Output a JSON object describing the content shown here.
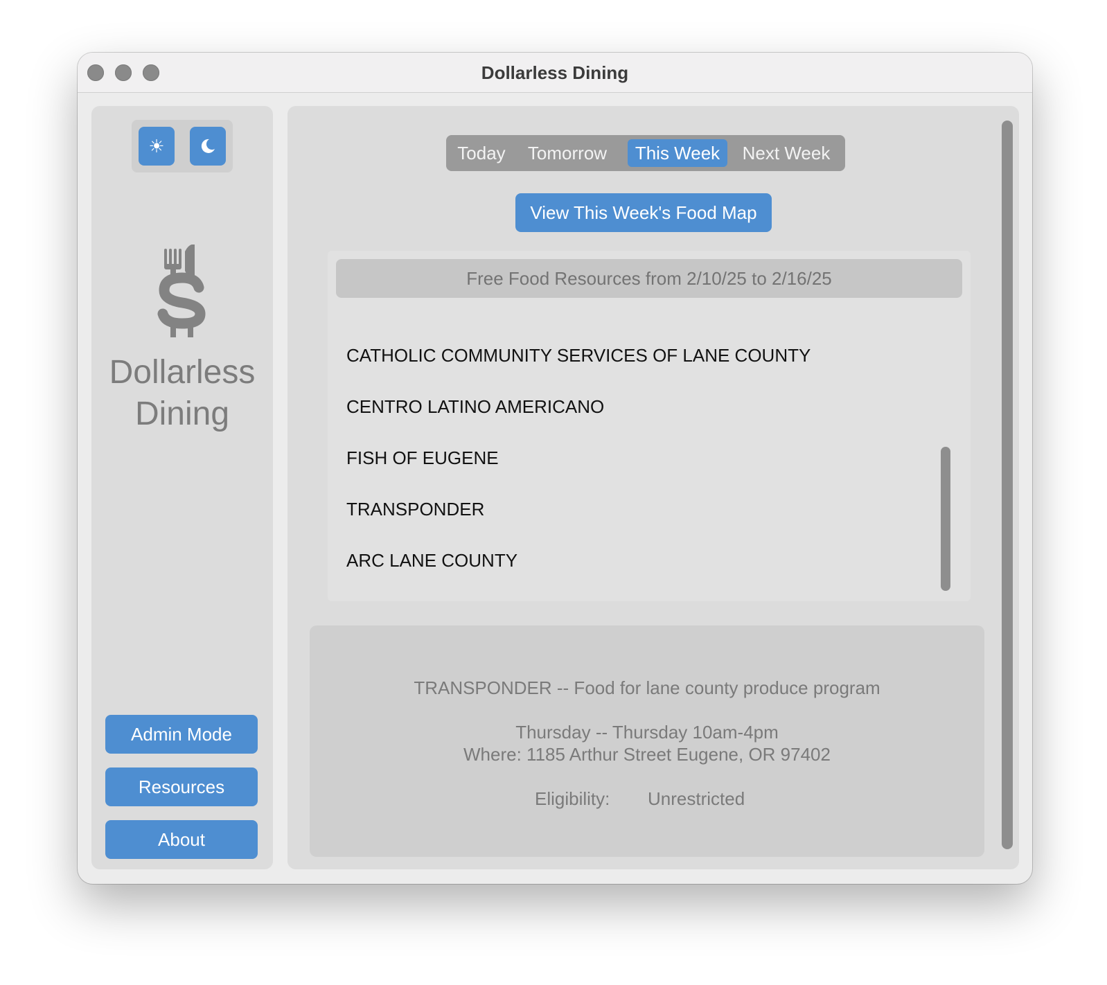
{
  "window": {
    "title": "Dollarless Dining"
  },
  "sidebar": {
    "theme_buttons": [
      {
        "name": "light",
        "icon": "sun-icon",
        "glyph": "☀"
      },
      {
        "name": "dark",
        "icon": "moon-icon",
        "glyph": "☾"
      }
    ],
    "logo_icon": "fork-knife-dollar-logo",
    "app_name_line1": "Dollarless",
    "app_name_line2": "Dining",
    "buttons": {
      "admin": "Admin Mode",
      "resources": "Resources",
      "about": "About"
    }
  },
  "main": {
    "tabs": [
      {
        "label": "Today",
        "selected": false
      },
      {
        "label": "Tomorrow",
        "selected": false
      },
      {
        "label": "This Week",
        "selected": true
      },
      {
        "label": "Next Week",
        "selected": false
      }
    ],
    "map_button": "View This Week's Food Map",
    "list": {
      "header": "Free Food Resources from 2/10/25 to 2/16/25",
      "items": [
        "CATHOLIC COMMUNITY SERVICES OF LANE COUNTY",
        "CENTRO LATINO AMERICANO",
        "FISH OF EUGENE",
        "TRANSPONDER",
        "ARC LANE COUNTY"
      ]
    },
    "detail": {
      "title": "TRANSPONDER -- Food for lane county produce program",
      "when": "Thursday -- Thursday 10am-4pm",
      "where": "Where: 1185 Arthur Street Eugene, OR 97402",
      "eligibility_label": "Eligibility:",
      "eligibility_value": "Unrestricted"
    }
  },
  "colors": {
    "accent": "#4e8ed1",
    "panel": "#dcdcdc",
    "segment_bg": "#9a9a9a"
  }
}
